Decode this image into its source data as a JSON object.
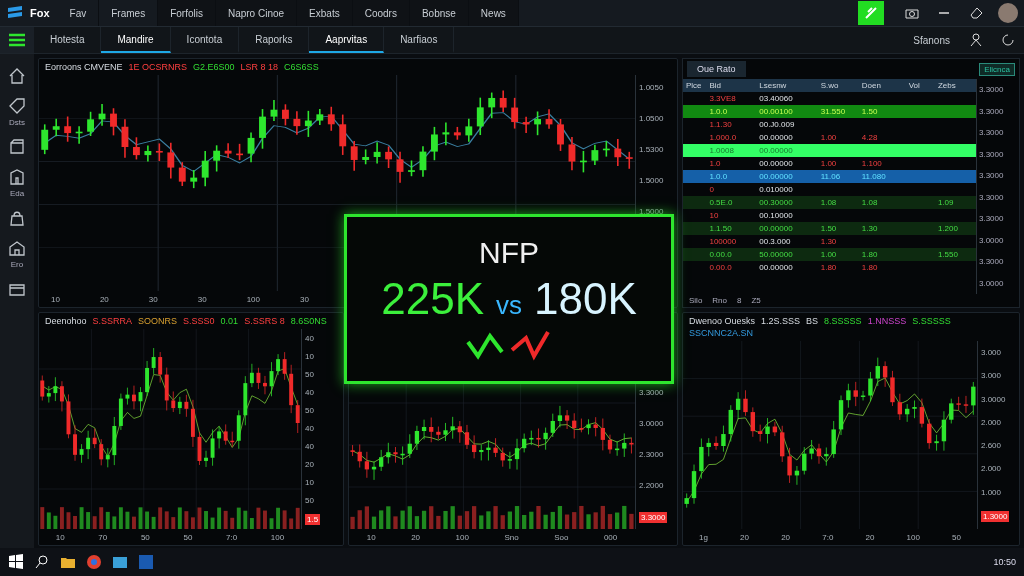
{
  "menu_bar": {
    "logo": "Fox",
    "items": [
      "Fav",
      "Frames",
      "Forfolis",
      "Napro Cinoe",
      "Exbats",
      "Coodrs",
      "Bobnse",
      "News"
    ]
  },
  "toolbar": {
    "tabs": [
      {
        "label": "Hotesta",
        "selected": false
      },
      {
        "label": "Mandire",
        "selected": true
      },
      {
        "label": "Icontota",
        "selected": false
      },
      {
        "label": "Raporks",
        "selected": false
      },
      {
        "label": "Aaprvitas",
        "selected": true
      },
      {
        "label": "Narfiaos",
        "selected": false
      }
    ],
    "right_label": "Sfanons"
  },
  "sidebar": {
    "items": [
      {
        "kind": "home"
      },
      {
        "kind": "tag",
        "label": "Dsts"
      },
      {
        "kind": "box"
      },
      {
        "kind": "building",
        "label": "Eda"
      },
      {
        "kind": "bag"
      },
      {
        "kind": "house",
        "label": "Ero"
      },
      {
        "kind": "window"
      }
    ]
  },
  "charts": [
    {
      "legend": [
        {
          "text": "Eorroons CMVENE",
          "kind": "title"
        },
        {
          "text": "1E OCSRNRS",
          "kind": "down"
        },
        {
          "text": "G2.E6S00",
          "kind": "up"
        },
        {
          "text": "LSR 8 18",
          "kind": "down"
        },
        {
          "text": "C6S6SS",
          "kind": "up"
        }
      ],
      "y_ticks": [
        "1.0050",
        "1.0500",
        "1.5300",
        "1.5000",
        "1.5000"
      ],
      "x_ticks": [
        "10",
        "20",
        "30",
        "30",
        "100",
        "30"
      ]
    },
    {
      "legend": [
        {
          "text": "Deenohoo",
          "kind": "title"
        },
        {
          "text": "S.SSRRA",
          "kind": "down"
        },
        {
          "text": "SOONRS",
          "kind": "warn"
        },
        {
          "text": "S.SSS0",
          "kind": "down"
        },
        {
          "text": "0.01",
          "kind": "up"
        },
        {
          "text": "S.SSRS 8",
          "kind": "down"
        },
        {
          "text": "8.6S0NS",
          "kind": "up"
        }
      ],
      "y_ticks": [
        "40",
        "10",
        "50",
        "40",
        "50",
        "40",
        "40",
        "20",
        "10",
        "50"
      ],
      "x_ticks": [
        "10",
        "70",
        "50",
        "50",
        "7:0",
        "100"
      ],
      "price_tag": "1.5"
    },
    {
      "y_ticks": [
        "3.3000",
        "3.0000",
        "2.3000",
        "2.2000"
      ],
      "x_ticks": [
        "10",
        "20",
        "100",
        "Sno",
        "Soo",
        "000"
      ],
      "price_tag": "3.3000"
    },
    {
      "legend": [
        {
          "text": "Dwenoo Ouesks",
          "kind": "title"
        },
        {
          "text": "1.2S.SSS",
          "kind": "title"
        },
        {
          "text": "BS",
          "kind": "title"
        },
        {
          "text": "8.SSSSS",
          "kind": "up"
        },
        {
          "text": "1.NNSSS",
          "kind": "purple"
        },
        {
          "text": "S.SSSSS",
          "kind": "up"
        },
        {
          "text": "SSCNNC2A.SN",
          "kind": "info"
        }
      ],
      "y_ticks": [
        "3.000",
        "3.000",
        "3.0000",
        "2.000",
        "2.600",
        "2.000",
        "1.000"
      ],
      "x_ticks": [
        "1g",
        "20",
        "20",
        "7:0",
        "20",
        "100",
        "50"
      ],
      "price_tag": "1.3000"
    }
  ],
  "order_book": {
    "tab": "Oue Rato",
    "badge": "Elicnca",
    "columns": [
      "Plce",
      "Bid",
      "Lsesnw",
      "S.wo",
      "Doen",
      "Vol",
      "Zebs"
    ],
    "rows": [
      {
        "kind": "plain",
        "cells": [
          "",
          "3.3VE8",
          "03.40060",
          "",
          "",
          "",
          ""
        ]
      },
      {
        "kind": "buy",
        "cells": [
          "",
          "1.0.0",
          "00.00100",
          "31.550",
          "1.50",
          "",
          ""
        ]
      },
      {
        "kind": "plain",
        "cells": [
          "",
          "1.1.30",
          "00.J0.009",
          "",
          "",
          "",
          ""
        ]
      },
      {
        "kind": "plain",
        "cells": [
          "",
          "1.000.0",
          "00.00000",
          "1.00",
          "4.28",
          "",
          ""
        ]
      },
      {
        "kind": "mid",
        "cells": [
          "",
          "1.0008",
          "00.00000",
          "",
          "",
          "",
          ""
        ]
      },
      {
        "kind": "plain",
        "cells": [
          "",
          "1.0",
          "00.00000",
          "1.00",
          "1.100",
          "",
          ""
        ]
      },
      {
        "kind": "selected",
        "cells": [
          "",
          "1.0.0",
          "00.00000",
          "11.06",
          "11.080",
          "",
          ""
        ]
      },
      {
        "kind": "plain",
        "cells": [
          "",
          "0",
          "0.010000",
          "",
          "",
          "",
          ""
        ]
      },
      {
        "kind": "dim",
        "cells": [
          "",
          "0.5E.0",
          "00.30000",
          "1.08",
          "1.08",
          "",
          "1.09"
        ]
      },
      {
        "kind": "plain",
        "cells": [
          "",
          "10",
          "00.10000",
          "",
          "",
          "",
          ""
        ]
      },
      {
        "kind": "dim",
        "cells": [
          "",
          "1.1.50",
          "00.00000",
          "1.50",
          "1.30",
          "",
          "1.200"
        ]
      },
      {
        "kind": "plain",
        "cells": [
          "",
          "100000",
          "00.3.000",
          "1.30",
          "",
          "",
          ""
        ]
      },
      {
        "kind": "dim",
        "cells": [
          "",
          "0.00.0",
          "50.00000",
          "1.00",
          "1.80",
          "",
          "1.550"
        ]
      },
      {
        "kind": "plain",
        "cells": [
          "",
          "0.00.0",
          "00.00000",
          "1.80",
          "1.80",
          "",
          ""
        ]
      }
    ],
    "price_axis": [
      "3.3000",
      "3.3000",
      "3.3000",
      "3.3000",
      "3.3000",
      "3.3000",
      "3.3000",
      "3.0000",
      "3.3000",
      "3.0000"
    ],
    "footer": [
      "Silo",
      "Rno",
      "8",
      "Z5"
    ]
  },
  "event": {
    "title": "NFP",
    "actual": "225K",
    "vs": "vs",
    "forecast": "180K"
  },
  "taskbar": {
    "clock": "10:50"
  }
}
